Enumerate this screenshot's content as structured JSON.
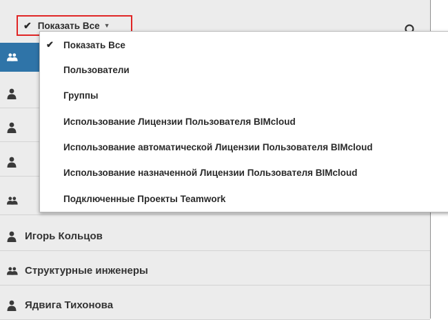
{
  "filter": {
    "selected_label": "Показать Все",
    "check_glyph": "✔",
    "caret_glyph": "▼",
    "icon": "checkmark-icon"
  },
  "search": {
    "icon": "search-icon"
  },
  "dropdown": {
    "items": [
      {
        "label": "Показать Все",
        "checked": true
      },
      {
        "label": "Пользователи",
        "checked": false
      },
      {
        "label": "Группы",
        "checked": false
      },
      {
        "label": "Использование Лицензии Пользователя BIMcloud",
        "checked": false
      },
      {
        "label": "Использование автоматической Лицензии Пользователя BIMcloud",
        "checked": false
      },
      {
        "label": "Использование назначенной Лицензии Пользователя BIMcloud",
        "checked": false
      },
      {
        "label": "Подключенные Проекты Teamwork",
        "checked": false
      }
    ]
  },
  "list": {
    "rows": [
      {
        "type": "group",
        "label": "",
        "selected": true,
        "icon": "group-icon"
      },
      {
        "type": "user",
        "label": "",
        "icon": "user-icon"
      },
      {
        "type": "user",
        "label": "",
        "icon": "user-icon"
      },
      {
        "type": "user",
        "label": "",
        "icon": "user-icon"
      },
      {
        "type": "group",
        "label": "",
        "icon": "group-icon"
      },
      {
        "type": "user",
        "label": "Игорь Кольцов",
        "icon": "user-icon"
      },
      {
        "type": "group",
        "label": "Структурные инженеры",
        "icon": "group-icon"
      },
      {
        "type": "user",
        "label": "Ядвига Тихонова",
        "icon": "user-icon"
      }
    ]
  },
  "colors": {
    "panel_bg": "#ececec",
    "selected_row": "#2f74a8",
    "highlight_border": "#e02424",
    "icon_dark": "#3a3a3a"
  }
}
